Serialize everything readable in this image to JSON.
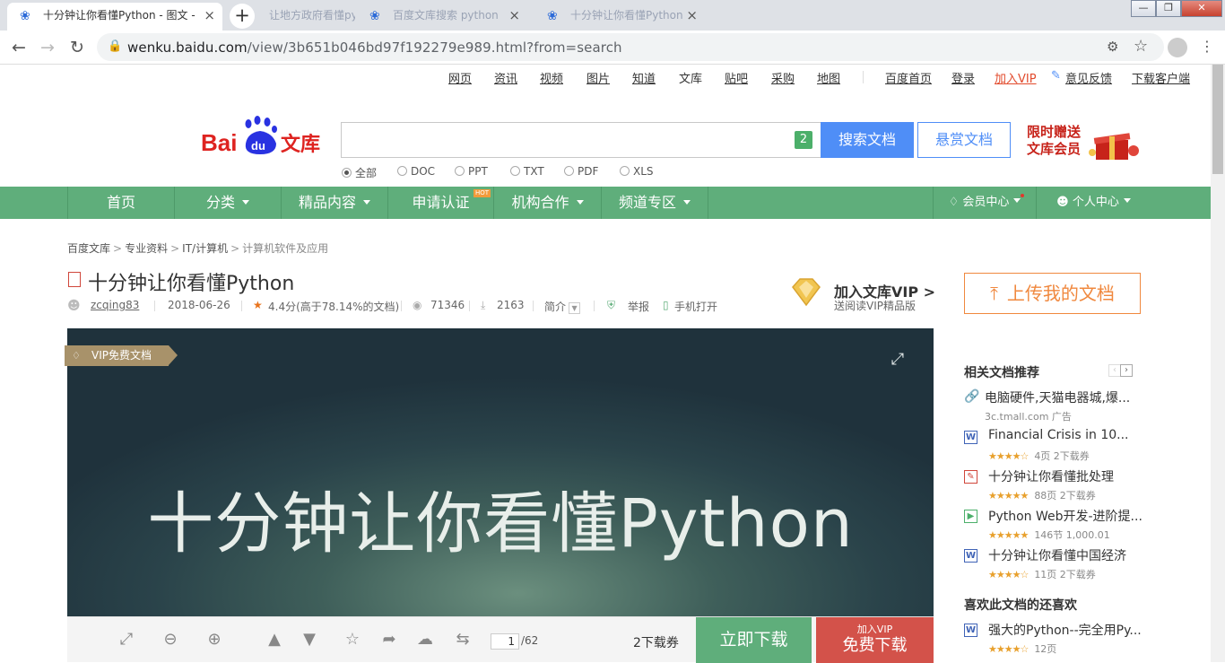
{
  "browser": {
    "tabs": [
      {
        "title": "十分钟让你看懂Python - 图文 -",
        "close": "×",
        "active": true
      },
      {
        "title": "让地方政府看懂python",
        "close": "×",
        "active": false
      },
      {
        "title": "百度文库搜索 python",
        "close": "×",
        "active": false
      },
      {
        "title": "十分钟让你看懂Python",
        "close": "×",
        "active": false
      }
    ],
    "new_tab": "+",
    "url": {
      "host": "wenku.baidu.com",
      "path": "/view/3b651b046bd97f192279e989.html?from=search"
    }
  },
  "topnav": {
    "links": [
      "网页",
      "资讯",
      "视频",
      "图片",
      "知道",
      "文库",
      "贴吧",
      "采购",
      "地图"
    ],
    "right_links": [
      "百度首页",
      "登录"
    ],
    "vip": "加入VIP",
    "feedback": "意见反馈",
    "client": "下载客户端"
  },
  "search": {
    "logo_text": "Baidu文库",
    "badge": "2",
    "search_button": "搜索文档",
    "reward_button": "悬赏文档",
    "promo_line1": "限时赠送",
    "promo_line2": "文库会员",
    "filters": [
      "全部",
      "DOC",
      "PPT",
      "TXT",
      "PDF",
      "XLS"
    ],
    "selected_filter": "全部"
  },
  "greenbar": {
    "items": [
      "首页",
      "分类",
      "精品内容",
      "申请认证",
      "机构合作",
      "频道专区"
    ],
    "hot_badge": "HOT",
    "member_center": "会员中心",
    "personal_center": "个人中心"
  },
  "breadcrumb": [
    "百度文库",
    "专业资料",
    "IT/计算机",
    "计算机软件及应用"
  ],
  "document": {
    "title": "十分钟让你看懂Python",
    "author": "zcqing83",
    "date": "2018-06-26",
    "rating": "4.4分(高于78.14%的文档)",
    "views": "71346",
    "downloads": "2163",
    "intro": "简介",
    "report": "举报",
    "mobile": "手机打开",
    "vip_join": "加入文库VIP >",
    "vip_sub": "送阅读VIP精品版",
    "vip_tag": "VIP免费文档",
    "slide_title": "十分钟让你看懂Python",
    "current_page": "1",
    "total_pages": "/62",
    "download_cost": "2下载券",
    "download_button": "立即下载",
    "free_vip_label": "加入VIP",
    "free_download": "免费下载"
  },
  "sidebar": {
    "upload_button": "上传我的文档",
    "related_heading": "相关文档推荐",
    "related": [
      {
        "type": "link",
        "title": "电脑硬件,天猫电器城,爆...",
        "sub": "3c.tmall.com   广告",
        "stars": ""
      },
      {
        "type": "word",
        "title": "Financial Crisis in 10...",
        "sub": "4页   2下载券",
        "stars": "★★★★☆"
      },
      {
        "type": "pdf",
        "title": "十分钟让你看懂批处理",
        "sub": "88页   2下载券",
        "stars": "★★★★★"
      },
      {
        "type": "video",
        "title": "Python Web开发-进阶提...",
        "sub": "146节   1,000.01",
        "stars": "★★★★★"
      },
      {
        "type": "word",
        "title": "十分钟让你看懂中国经济",
        "sub": "11页   2下载券",
        "stars": "★★★★☆"
      }
    ],
    "like_heading": "喜欢此文档的还喜欢",
    "like": [
      {
        "type": "word",
        "title": "强大的Python--完全用Py...",
        "sub": "12页",
        "stars": "★★★★☆"
      }
    ]
  }
}
